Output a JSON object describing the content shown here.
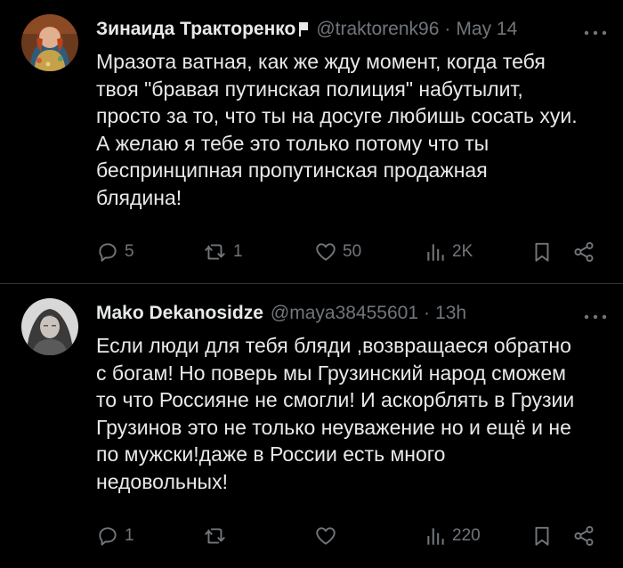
{
  "tweets": [
    {
      "author_name": "Зинаида Тракторенко",
      "handle": "@traktorenk96",
      "separator": "·",
      "time": "May 14",
      "lines": [
        "Мразота ватная, как же жду момент, когда тебя",
        "твоя \"бравая путинская полиция\" набутылит,",
        "просто за то, что ты на досуге любишь сосать хуи.",
        "А желаю я тебе это только потому что ты",
        "беспринципная пропутинская продажная",
        "блядина!"
      ],
      "replies": "5",
      "retweets": "1",
      "likes": "50",
      "views": "2K"
    },
    {
      "author_name": "Mako Dekanosidze",
      "handle": "@maya38455601",
      "separator": "·",
      "time": "13h",
      "lines": [
        "Если люди для тебя бляди ,возвращаеся обратно",
        "с богам! Но поверь мы Грузинский народ сможем",
        "то что Россияне не смогли! И аскорблять в Грузии",
        "Грузинов это не только неуважение но и ещё и не",
        "по мужски!даже в России есть много",
        "недовольных!"
      ],
      "replies": "1",
      "retweets": "",
      "likes": "",
      "views": "220"
    }
  ],
  "icons": {
    "reply": "reply-icon",
    "retweet": "retweet-icon",
    "like": "heart-icon",
    "views": "views-icon",
    "bookmark": "bookmark-icon",
    "share": "share-icon",
    "more": "more-icon",
    "flag": "flag-icon"
  },
  "colors": {
    "background": "#000000",
    "text": "#e7e9ea",
    "muted": "#71767b",
    "divider": "#2f3336"
  }
}
